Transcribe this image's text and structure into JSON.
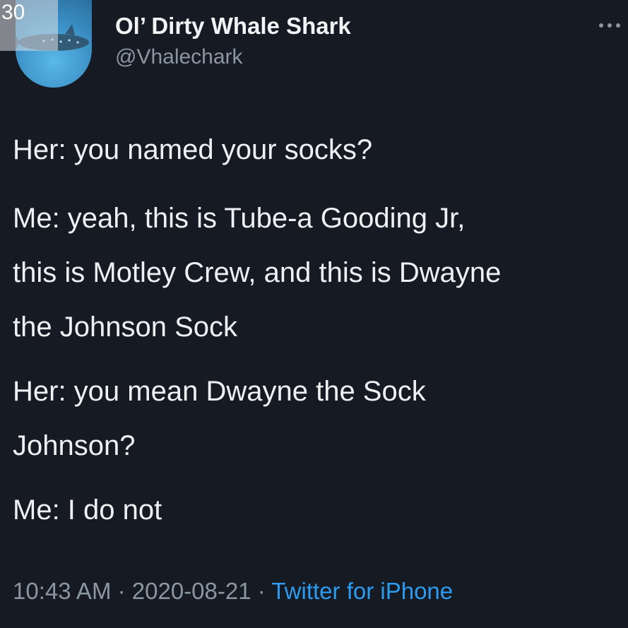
{
  "overlay": {
    "counter": "30"
  },
  "author": {
    "display_name": "Ol’ Dirty Whale Shark",
    "handle": "@Vhalechark"
  },
  "tweet": {
    "paragraphs": [
      {
        "lines": [
          "Her: you named your socks?"
        ]
      },
      {
        "lines": [
          "Me: yeah, this is Tube-a Gooding Jr,",
          "this is Motley Crew, and this is Dwayne",
          "the Johnson Sock"
        ]
      },
      {
        "lines": [
          "Her: you mean Dwayne the Sock",
          "Johnson?"
        ]
      },
      {
        "lines": [
          "Me: I do not"
        ]
      }
    ]
  },
  "meta": {
    "time": "10:43 AM",
    "separator": "·",
    "date": "2020-08-21",
    "source": "Twitter for iPhone"
  },
  "icons": {
    "more": "more-horizontal-icon",
    "avatar": "whale-shark-avatar"
  },
  "colors": {
    "background": "#151a23",
    "text": "#eef0f3",
    "secondary": "#8b96a3",
    "link": "#2d9cf0"
  }
}
